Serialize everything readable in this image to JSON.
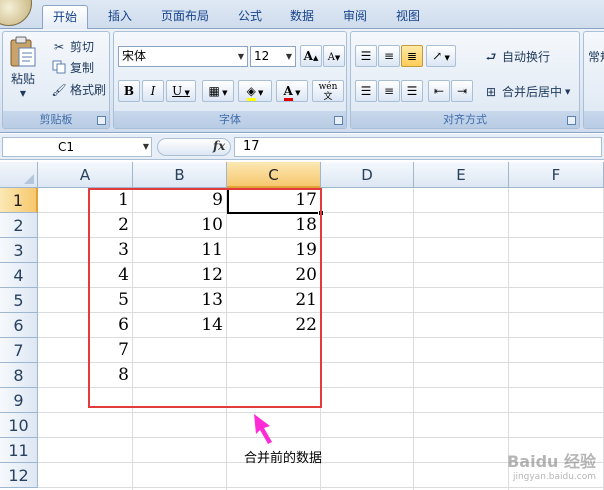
{
  "tabs": [
    {
      "label": "开始",
      "active": true
    },
    {
      "label": "插入",
      "active": false
    },
    {
      "label": "页面布局",
      "active": false
    },
    {
      "label": "公式",
      "active": false
    },
    {
      "label": "数据",
      "active": false
    },
    {
      "label": "审阅",
      "active": false
    },
    {
      "label": "视图",
      "active": false
    }
  ],
  "clipboard": {
    "paste_label": "粘贴",
    "cut_label": "剪切",
    "copy_label": "复制",
    "format_painter_label": "格式刷",
    "group_label": "剪贴板"
  },
  "font": {
    "name": "宋体",
    "size": "12",
    "bold": "B",
    "italic": "I",
    "underline": "U",
    "group_label": "字体",
    "grow": "A",
    "shrink": "A",
    "phonetic": "wén"
  },
  "alignment": {
    "wrap_label": "自动换行",
    "merge_label": "合并后居中",
    "group_label": "对齐方式"
  },
  "number": {
    "format_label": "常规"
  },
  "formula_bar": {
    "name_box": "C1",
    "fx": "fx",
    "value": "17"
  },
  "sheet": {
    "columns": [
      "A",
      "B",
      "C",
      "D",
      "E",
      "F"
    ],
    "rows": [
      "1",
      "2",
      "3",
      "4",
      "5",
      "6",
      "7",
      "8",
      "9",
      "10",
      "11",
      "12"
    ],
    "selected_column": "C",
    "selected_row": "1",
    "cells": {
      "A": [
        "1",
        "2",
        "3",
        "4",
        "5",
        "6",
        "7",
        "8"
      ],
      "B": [
        "9",
        "10",
        "11",
        "12",
        "13",
        "14"
      ],
      "C": [
        "17",
        "18",
        "19",
        "20",
        "21",
        "22"
      ]
    }
  },
  "annotation": {
    "text": "合并前的数据",
    "arrow_color": "#ff2bd6",
    "box_color": "#e23b3b"
  },
  "watermark": {
    "brand": "Baidu 经验",
    "url": "jingyan.baidu.com"
  },
  "colors": {
    "ribbon_text": "#15428b",
    "selection_header": "#f7c86e"
  }
}
